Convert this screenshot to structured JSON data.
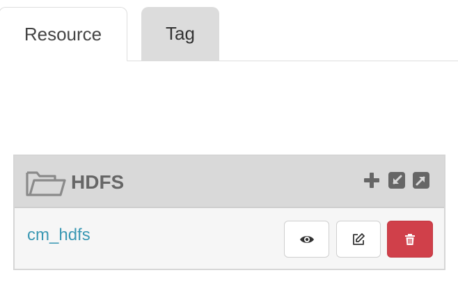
{
  "tabs": [
    {
      "label": "Resource",
      "active": true
    },
    {
      "label": "Tag",
      "active": false
    }
  ],
  "service": {
    "name": "HDFS",
    "icon": "folder-open-icon",
    "header_actions": [
      "plus-icon",
      "compress-icon",
      "expand-icon"
    ]
  },
  "resources": [
    {
      "name": "cm_hdfs",
      "actions": [
        "eye-icon",
        "edit-icon",
        "trash-icon"
      ]
    }
  ],
  "colors": {
    "link": "#3a98b3",
    "delete": "#d0404a",
    "header_bg": "#d9d9d9"
  }
}
